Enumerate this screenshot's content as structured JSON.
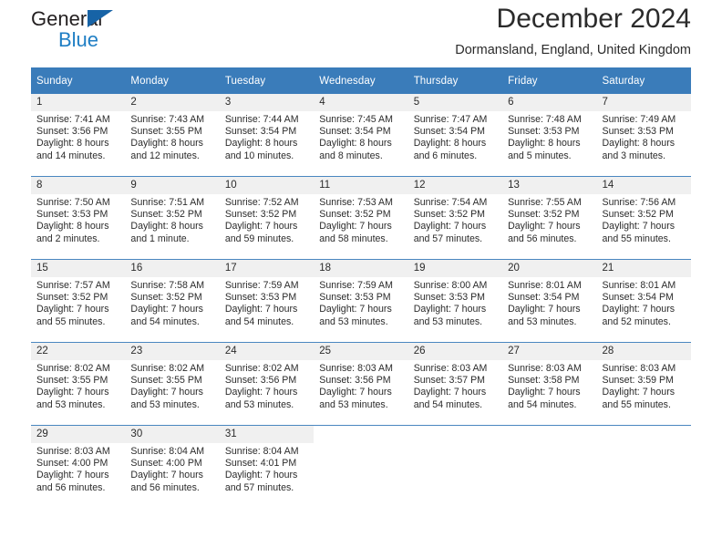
{
  "brand": {
    "name_part1": "General",
    "name_part2": "Blue",
    "triangle_color": "#1763a6",
    "blue_color": "#1f7ec4"
  },
  "header": {
    "title": "December 2024",
    "subtitle": "Dormansland, England, United Kingdom"
  },
  "theme": {
    "header_bg": "#3a7cba",
    "daynum_bg": "#f0f0f0",
    "row_separator": "#4a87c0",
    "text": "#2b2b2b"
  },
  "weekday_headers": [
    "Sunday",
    "Monday",
    "Tuesday",
    "Wednesday",
    "Thursday",
    "Friday",
    "Saturday"
  ],
  "weeks": [
    [
      {
        "day": "1",
        "sunrise": "Sunrise: 7:41 AM",
        "sunset": "Sunset: 3:56 PM",
        "daylight_1": "Daylight: 8 hours",
        "daylight_2": "and 14 minutes."
      },
      {
        "day": "2",
        "sunrise": "Sunrise: 7:43 AM",
        "sunset": "Sunset: 3:55 PM",
        "daylight_1": "Daylight: 8 hours",
        "daylight_2": "and 12 minutes."
      },
      {
        "day": "3",
        "sunrise": "Sunrise: 7:44 AM",
        "sunset": "Sunset: 3:54 PM",
        "daylight_1": "Daylight: 8 hours",
        "daylight_2": "and 10 minutes."
      },
      {
        "day": "4",
        "sunrise": "Sunrise: 7:45 AM",
        "sunset": "Sunset: 3:54 PM",
        "daylight_1": "Daylight: 8 hours",
        "daylight_2": "and 8 minutes."
      },
      {
        "day": "5",
        "sunrise": "Sunrise: 7:47 AM",
        "sunset": "Sunset: 3:54 PM",
        "daylight_1": "Daylight: 8 hours",
        "daylight_2": "and 6 minutes."
      },
      {
        "day": "6",
        "sunrise": "Sunrise: 7:48 AM",
        "sunset": "Sunset: 3:53 PM",
        "daylight_1": "Daylight: 8 hours",
        "daylight_2": "and 5 minutes."
      },
      {
        "day": "7",
        "sunrise": "Sunrise: 7:49 AM",
        "sunset": "Sunset: 3:53 PM",
        "daylight_1": "Daylight: 8 hours",
        "daylight_2": "and 3 minutes."
      }
    ],
    [
      {
        "day": "8",
        "sunrise": "Sunrise: 7:50 AM",
        "sunset": "Sunset: 3:53 PM",
        "daylight_1": "Daylight: 8 hours",
        "daylight_2": "and 2 minutes."
      },
      {
        "day": "9",
        "sunrise": "Sunrise: 7:51 AM",
        "sunset": "Sunset: 3:52 PM",
        "daylight_1": "Daylight: 8 hours",
        "daylight_2": "and 1 minute."
      },
      {
        "day": "10",
        "sunrise": "Sunrise: 7:52 AM",
        "sunset": "Sunset: 3:52 PM",
        "daylight_1": "Daylight: 7 hours",
        "daylight_2": "and 59 minutes."
      },
      {
        "day": "11",
        "sunrise": "Sunrise: 7:53 AM",
        "sunset": "Sunset: 3:52 PM",
        "daylight_1": "Daylight: 7 hours",
        "daylight_2": "and 58 minutes."
      },
      {
        "day": "12",
        "sunrise": "Sunrise: 7:54 AM",
        "sunset": "Sunset: 3:52 PM",
        "daylight_1": "Daylight: 7 hours",
        "daylight_2": "and 57 minutes."
      },
      {
        "day": "13",
        "sunrise": "Sunrise: 7:55 AM",
        "sunset": "Sunset: 3:52 PM",
        "daylight_1": "Daylight: 7 hours",
        "daylight_2": "and 56 minutes."
      },
      {
        "day": "14",
        "sunrise": "Sunrise: 7:56 AM",
        "sunset": "Sunset: 3:52 PM",
        "daylight_1": "Daylight: 7 hours",
        "daylight_2": "and 55 minutes."
      }
    ],
    [
      {
        "day": "15",
        "sunrise": "Sunrise: 7:57 AM",
        "sunset": "Sunset: 3:52 PM",
        "daylight_1": "Daylight: 7 hours",
        "daylight_2": "and 55 minutes."
      },
      {
        "day": "16",
        "sunrise": "Sunrise: 7:58 AM",
        "sunset": "Sunset: 3:52 PM",
        "daylight_1": "Daylight: 7 hours",
        "daylight_2": "and 54 minutes."
      },
      {
        "day": "17",
        "sunrise": "Sunrise: 7:59 AM",
        "sunset": "Sunset: 3:53 PM",
        "daylight_1": "Daylight: 7 hours",
        "daylight_2": "and 54 minutes."
      },
      {
        "day": "18",
        "sunrise": "Sunrise: 7:59 AM",
        "sunset": "Sunset: 3:53 PM",
        "daylight_1": "Daylight: 7 hours",
        "daylight_2": "and 53 minutes."
      },
      {
        "day": "19",
        "sunrise": "Sunrise: 8:00 AM",
        "sunset": "Sunset: 3:53 PM",
        "daylight_1": "Daylight: 7 hours",
        "daylight_2": "and 53 minutes."
      },
      {
        "day": "20",
        "sunrise": "Sunrise: 8:01 AM",
        "sunset": "Sunset: 3:54 PM",
        "daylight_1": "Daylight: 7 hours",
        "daylight_2": "and 53 minutes."
      },
      {
        "day": "21",
        "sunrise": "Sunrise: 8:01 AM",
        "sunset": "Sunset: 3:54 PM",
        "daylight_1": "Daylight: 7 hours",
        "daylight_2": "and 52 minutes."
      }
    ],
    [
      {
        "day": "22",
        "sunrise": "Sunrise: 8:02 AM",
        "sunset": "Sunset: 3:55 PM",
        "daylight_1": "Daylight: 7 hours",
        "daylight_2": "and 53 minutes."
      },
      {
        "day": "23",
        "sunrise": "Sunrise: 8:02 AM",
        "sunset": "Sunset: 3:55 PM",
        "daylight_1": "Daylight: 7 hours",
        "daylight_2": "and 53 minutes."
      },
      {
        "day": "24",
        "sunrise": "Sunrise: 8:02 AM",
        "sunset": "Sunset: 3:56 PM",
        "daylight_1": "Daylight: 7 hours",
        "daylight_2": "and 53 minutes."
      },
      {
        "day": "25",
        "sunrise": "Sunrise: 8:03 AM",
        "sunset": "Sunset: 3:56 PM",
        "daylight_1": "Daylight: 7 hours",
        "daylight_2": "and 53 minutes."
      },
      {
        "day": "26",
        "sunrise": "Sunrise: 8:03 AM",
        "sunset": "Sunset: 3:57 PM",
        "daylight_1": "Daylight: 7 hours",
        "daylight_2": "and 54 minutes."
      },
      {
        "day": "27",
        "sunrise": "Sunrise: 8:03 AM",
        "sunset": "Sunset: 3:58 PM",
        "daylight_1": "Daylight: 7 hours",
        "daylight_2": "and 54 minutes."
      },
      {
        "day": "28",
        "sunrise": "Sunrise: 8:03 AM",
        "sunset": "Sunset: 3:59 PM",
        "daylight_1": "Daylight: 7 hours",
        "daylight_2": "and 55 minutes."
      }
    ],
    [
      {
        "day": "29",
        "sunrise": "Sunrise: 8:03 AM",
        "sunset": "Sunset: 4:00 PM",
        "daylight_1": "Daylight: 7 hours",
        "daylight_2": "and 56 minutes."
      },
      {
        "day": "30",
        "sunrise": "Sunrise: 8:04 AM",
        "sunset": "Sunset: 4:00 PM",
        "daylight_1": "Daylight: 7 hours",
        "daylight_2": "and 56 minutes."
      },
      {
        "day": "31",
        "sunrise": "Sunrise: 8:04 AM",
        "sunset": "Sunset: 4:01 PM",
        "daylight_1": "Daylight: 7 hours",
        "daylight_2": "and 57 minutes."
      },
      {
        "day": "",
        "sunrise": "",
        "sunset": "",
        "daylight_1": "",
        "daylight_2": ""
      },
      {
        "day": "",
        "sunrise": "",
        "sunset": "",
        "daylight_1": "",
        "daylight_2": ""
      },
      {
        "day": "",
        "sunrise": "",
        "sunset": "",
        "daylight_1": "",
        "daylight_2": ""
      },
      {
        "day": "",
        "sunrise": "",
        "sunset": "",
        "daylight_1": "",
        "daylight_2": ""
      }
    ]
  ]
}
